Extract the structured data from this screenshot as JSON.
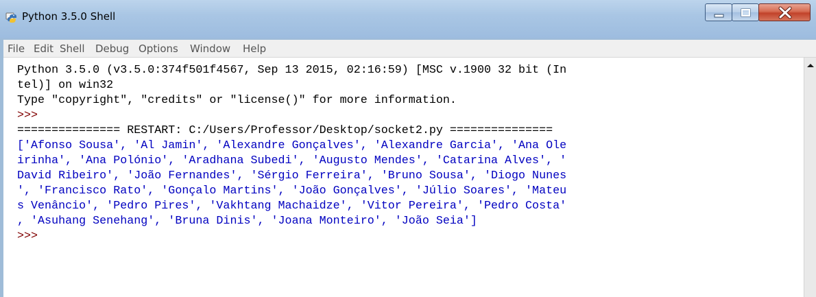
{
  "window": {
    "title": "Python 3.5.0 Shell",
    "title_icon": "python-idle-icon"
  },
  "controls": {
    "minimize_icon": "minimize-icon",
    "maximize_icon": "maximize-icon",
    "close_icon": "close-icon"
  },
  "menu": {
    "items": [
      "File",
      "Edit",
      "Shell",
      "Debug",
      "Options",
      "Window",
      "Help"
    ]
  },
  "shell": {
    "lines": [
      {
        "text": "Python 3.5.0 (v3.5.0:374f501f4567, Sep 13 2015, 02:16:59) [MSC v.1900 32 bit (In",
        "color": "#000000"
      },
      {
        "text": "tel)] on win32",
        "color": "#000000"
      },
      {
        "text": "Type \"copyright\", \"credits\" or \"license()\" for more information.",
        "color": "#000000"
      },
      {
        "text": ">>>",
        "color": "#800000"
      },
      {
        "text": "=============== RESTART: C:/Users/Professor/Desktop/socket2.py ===============",
        "color": "#000000"
      },
      {
        "text": "['Afonso Sousa', 'Al Jamin', 'Alexandre Gonçalves', 'Alexandre Garcia', 'Ana Ole",
        "color": "#0000c0"
      },
      {
        "text": "irinha', 'Ana Polónio', 'Aradhana Subedi', 'Augusto Mendes', 'Catarina Alves', '",
        "color": "#0000c0"
      },
      {
        "text": "David Ribeiro', 'João Fernandes', 'Sérgio Ferreira', 'Bruno Sousa', 'Diogo Nunes",
        "color": "#0000c0"
      },
      {
        "text": "', 'Francisco Rato', 'Gonçalo Martins', 'João Gonçalves', 'Júlio Soares', 'Mateu",
        "color": "#0000c0"
      },
      {
        "text": "s Venâncio', 'Pedro Pires', 'Vakhtang Machaidze', 'Vitor Pereira', 'Pedro Costa'",
        "color": "#0000c0"
      },
      {
        "text": ", 'Asuhang Senehang', 'Bruna Dinis', 'Joana Monteiro', 'João Seia']",
        "color": "#0000c0"
      },
      {
        "text": ">>>",
        "color": "#800000"
      }
    ]
  },
  "scrollbar": {
    "up_icon": "scroll-up-arrow-icon"
  }
}
